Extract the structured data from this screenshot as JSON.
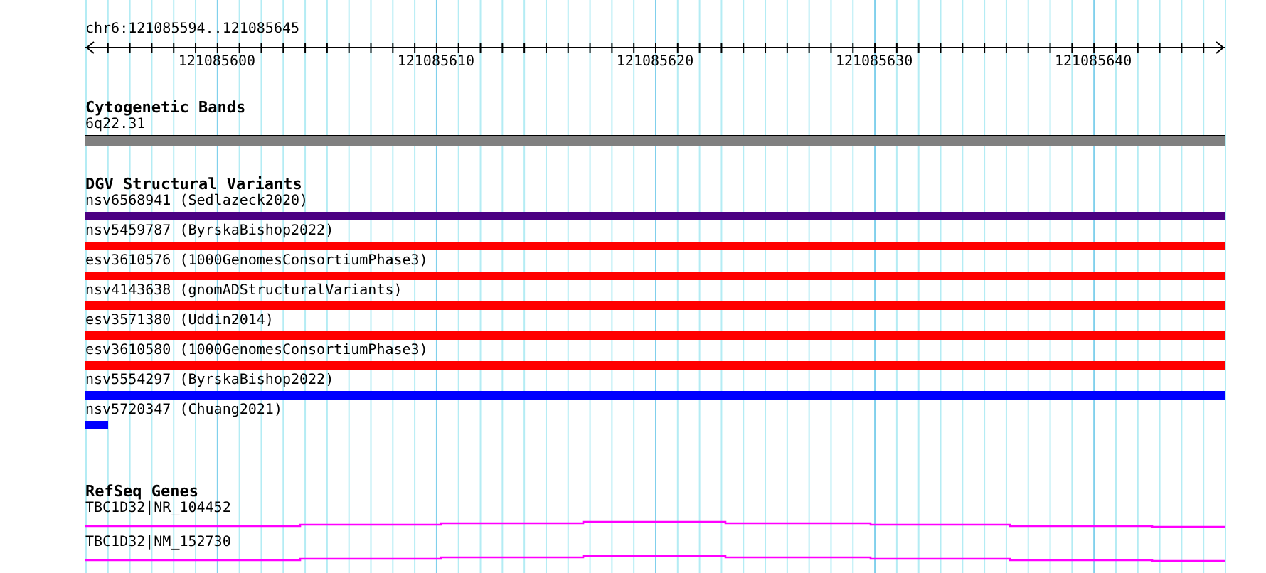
{
  "ruler": {
    "location": "chr6:121085594..121085645",
    "ticks": [
      "121085600",
      "121085610",
      "121085620",
      "121085630",
      "121085640"
    ]
  },
  "tracks": [
    {
      "kind": "bands",
      "title": "Cytogenetic Bands",
      "features": [
        {
          "label": "6q22.31"
        }
      ]
    },
    {
      "kind": "variants",
      "title": "DGV Structural Variants",
      "features": [
        {
          "label": "nsv6568941 (Sedlazeck2020)",
          "color": "#4b0082",
          "kind": "span"
        },
        {
          "label": "nsv5459787 (ByrskaBishop2022)",
          "color": "#ff0000",
          "kind": "span"
        },
        {
          "label": "esv3610576 (1000GenomesConsortiumPhase3)",
          "color": "#ff0000",
          "kind": "span"
        },
        {
          "label": "nsv4143638 (gnomADStructuralVariants)",
          "color": "#ff0000",
          "kind": "span"
        },
        {
          "label": "esv3571380 (Uddin2014)",
          "color": "#ff0000",
          "kind": "span"
        },
        {
          "label": "esv3610580 (1000GenomesConsortiumPhase3)",
          "color": "#ff0000",
          "kind": "span"
        },
        {
          "label": "nsv5554297 (ByrskaBishop2022)",
          "color": "#0000ff",
          "kind": "span"
        },
        {
          "label": "nsv5720347 (Chuang2021)",
          "color": "#0000ff",
          "kind": "point"
        }
      ]
    },
    {
      "kind": "genes",
      "title": "RefSeq Genes",
      "features": [
        {
          "label": "TBC1D32|NR_104452"
        },
        {
          "label": "TBC1D32|NM_152730"
        }
      ]
    }
  ]
}
